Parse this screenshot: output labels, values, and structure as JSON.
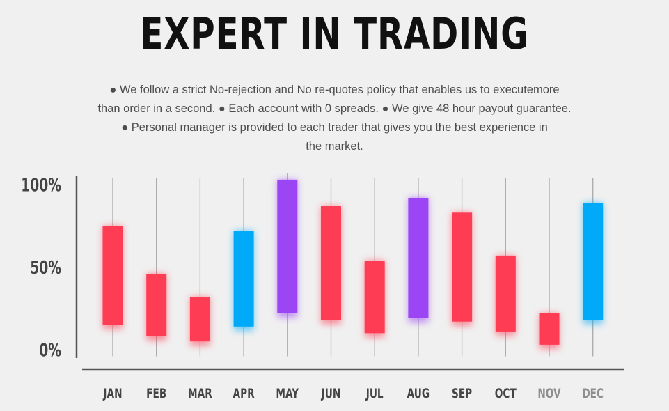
{
  "title": "EXPERT IN TRADING",
  "description": {
    "line1": "● We follow a strict No-rejection and No re-quotes policy that enables us to executemore",
    "line2": "than order in a second. ● Each account with 0 spreads. ● We give 48 hour payout guarantee.",
    "line3": "● Personal manager is provided to each trader that gives you the best experience in",
    "line4": "the market."
  },
  "colors": {
    "red": "#fe3d55",
    "blue": "#00aaf8",
    "purple": "#9b45f5",
    "wick": "#a9a9a9",
    "axis": "#555555",
    "label": "#444444",
    "label_faded": "#8e8e8e"
  },
  "chart_data": {
    "type": "candlestick",
    "title": "",
    "xlabel": "",
    "ylabel": "",
    "ylim": [
      0,
      100
    ],
    "y_ticks": [
      {
        "value": 0,
        "label": "0%"
      },
      {
        "value": 50,
        "label": "50%"
      },
      {
        "value": 100,
        "label": "100%"
      }
    ],
    "grid": false,
    "categories": [
      "JAN",
      "FEB",
      "MAR",
      "APR",
      "MAY",
      "JUN",
      "JUL",
      "AUG",
      "SEP",
      "OCT",
      "NOV",
      "DEC"
    ],
    "candles": [
      {
        "month": "JAN",
        "low": -4,
        "high": 104,
        "open": 15,
        "close": 75,
        "color": "red"
      },
      {
        "month": "FEB",
        "low": -4,
        "high": 104,
        "open": 8,
        "close": 46,
        "color": "red"
      },
      {
        "month": "MAR",
        "low": -4,
        "high": 104,
        "open": 5,
        "close": 32,
        "color": "red"
      },
      {
        "month": "APR",
        "low": -4,
        "high": 104,
        "open": 14,
        "close": 72,
        "color": "blue"
      },
      {
        "month": "MAY",
        "low": -4,
        "high": 107,
        "open": 22,
        "close": 103,
        "color": "purple"
      },
      {
        "month": "JUN",
        "low": -4,
        "high": 104,
        "open": 18,
        "close": 87,
        "color": "red"
      },
      {
        "month": "JUL",
        "low": -4,
        "high": 104,
        "open": 10,
        "close": 54,
        "color": "red"
      },
      {
        "month": "AUG",
        "low": -4,
        "high": 104,
        "open": 19,
        "close": 92,
        "color": "purple"
      },
      {
        "month": "SEP",
        "low": -4,
        "high": 104,
        "open": 17,
        "close": 83,
        "color": "red"
      },
      {
        "month": "OCT",
        "low": -4,
        "high": 104,
        "open": 11,
        "close": 57,
        "color": "red"
      },
      {
        "month": "NOV",
        "low": -4,
        "high": 104,
        "open": 3,
        "close": 22,
        "color": "red"
      },
      {
        "month": "DEC",
        "low": -4,
        "high": 104,
        "open": 18,
        "close": 89,
        "color": "blue"
      }
    ],
    "faded_labels": [
      "NOV",
      "DEC"
    ]
  }
}
